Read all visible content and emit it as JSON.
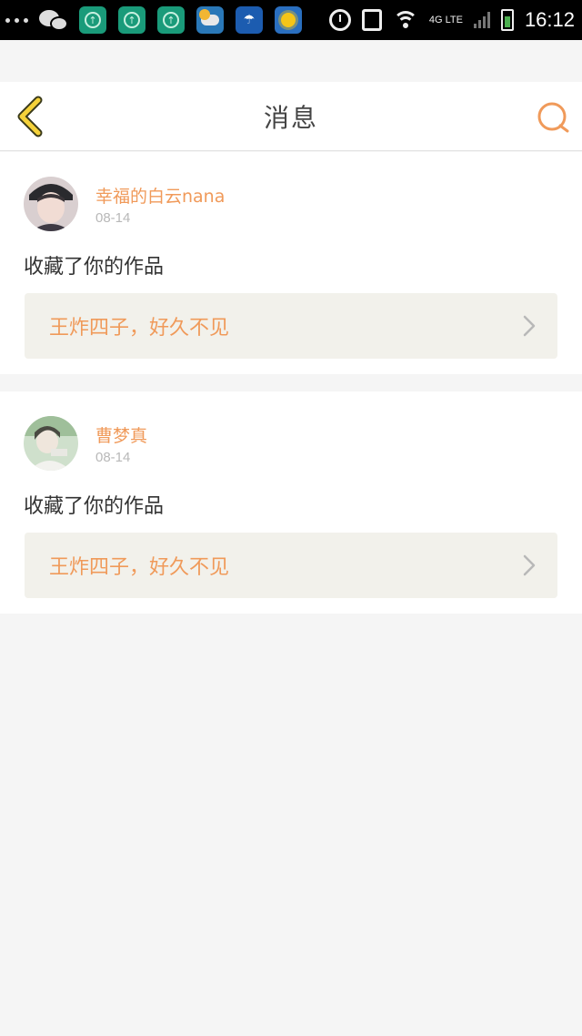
{
  "status_bar": {
    "time": "16:12",
    "network": "4G LTE"
  },
  "header": {
    "title": "消息",
    "accent_color": "#f09a5a",
    "back_icon": "chevron-left-icon",
    "search_icon": "search-icon"
  },
  "messages": [
    {
      "user_name": "幸福的白云nana",
      "date": "08-14",
      "action": "收藏了你的作品",
      "work_title": "王炸四子，好久不见"
    },
    {
      "user_name": "曹梦真",
      "date": "08-14",
      "action": "收藏了你的作品",
      "work_title": "王炸四子，好久不见"
    }
  ]
}
